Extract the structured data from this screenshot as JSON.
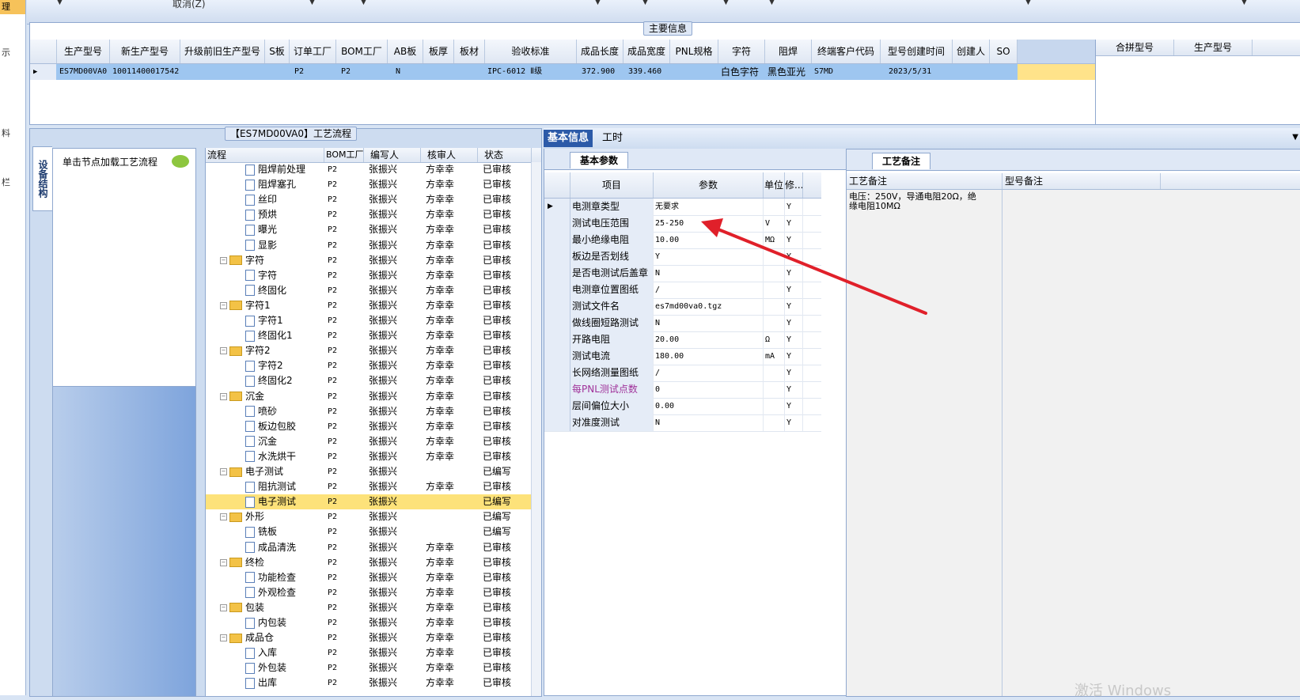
{
  "leftstrip": {
    "active_tab": "理",
    "glyphs": [
      "示",
      "料",
      "栏"
    ]
  },
  "toolbar": {
    "cancel_label": "取消(Z)"
  },
  "main_info": {
    "caption": "主要信息",
    "columns": [
      "生产型号",
      "新生产型号",
      "升级前旧生产型号",
      "S板",
      "订单工厂",
      "BOM工厂",
      "AB板",
      "板厚",
      "板材",
      "验收标准",
      "成品长度",
      "成品宽度",
      "PNL规格",
      "字符",
      "阻焊",
      "终端客户代码",
      "型号创建时间",
      "创建人",
      "SO"
    ],
    "row": [
      "ES7MD00VA0",
      "10011400017542",
      "",
      "",
      "P2",
      "P2",
      "N",
      "",
      "",
      "IPC-6012 Ⅱ级",
      "372.900",
      "339.460",
      "",
      "白色字符",
      "黑色亚光",
      "S7MD",
      "2023/5/31",
      "",
      ""
    ],
    "right_columns": [
      "合拼型号",
      "生产型号"
    ]
  },
  "process": {
    "caption": "【ES7MD00VA0】工艺流程",
    "vertical_tab": "设备结构",
    "load_hint": "单击节点加载工艺流程",
    "columns": [
      "流程",
      "BOM工厂",
      "编写人",
      "核审人",
      "状态"
    ],
    "rows": [
      {
        "level": 2,
        "type": "doc",
        "name": "阻焊前处理",
        "bom": "P2",
        "writer": "张振兴",
        "checker": "方幸幸",
        "status": "已审核"
      },
      {
        "level": 2,
        "type": "doc",
        "name": "阻焊塞孔",
        "bom": "P2",
        "writer": "张振兴",
        "checker": "方幸幸",
        "status": "已审核"
      },
      {
        "level": 2,
        "type": "doc",
        "name": "丝印",
        "bom": "P2",
        "writer": "张振兴",
        "checker": "方幸幸",
        "status": "已审核"
      },
      {
        "level": 2,
        "type": "doc",
        "name": "预烘",
        "bom": "P2",
        "writer": "张振兴",
        "checker": "方幸幸",
        "status": "已审核"
      },
      {
        "level": 2,
        "type": "doc",
        "name": "曝光",
        "bom": "P2",
        "writer": "张振兴",
        "checker": "方幸幸",
        "status": "已审核"
      },
      {
        "level": 2,
        "type": "doc",
        "name": "显影",
        "bom": "P2",
        "writer": "张振兴",
        "checker": "方幸幸",
        "status": "已审核"
      },
      {
        "level": 1,
        "type": "folder",
        "name": "字符",
        "bom": "P2",
        "writer": "张振兴",
        "checker": "方幸幸",
        "status": "已审核"
      },
      {
        "level": 2,
        "type": "doc",
        "name": "字符",
        "bom": "P2",
        "writer": "张振兴",
        "checker": "方幸幸",
        "status": "已审核"
      },
      {
        "level": 2,
        "type": "doc",
        "name": "终固化",
        "bom": "P2",
        "writer": "张振兴",
        "checker": "方幸幸",
        "status": "已审核"
      },
      {
        "level": 1,
        "type": "folder",
        "name": "字符1",
        "bom": "P2",
        "writer": "张振兴",
        "checker": "方幸幸",
        "status": "已审核"
      },
      {
        "level": 2,
        "type": "doc",
        "name": "字符1",
        "bom": "P2",
        "writer": "张振兴",
        "checker": "方幸幸",
        "status": "已审核"
      },
      {
        "level": 2,
        "type": "doc",
        "name": "终固化1",
        "bom": "P2",
        "writer": "张振兴",
        "checker": "方幸幸",
        "status": "已审核"
      },
      {
        "level": 1,
        "type": "folder",
        "name": "字符2",
        "bom": "P2",
        "writer": "张振兴",
        "checker": "方幸幸",
        "status": "已审核"
      },
      {
        "level": 2,
        "type": "doc",
        "name": "字符2",
        "bom": "P2",
        "writer": "张振兴",
        "checker": "方幸幸",
        "status": "已审核"
      },
      {
        "level": 2,
        "type": "doc",
        "name": "终固化2",
        "bom": "P2",
        "writer": "张振兴",
        "checker": "方幸幸",
        "status": "已审核"
      },
      {
        "level": 1,
        "type": "folder",
        "name": "沉金",
        "bom": "P2",
        "writer": "张振兴",
        "checker": "方幸幸",
        "status": "已审核"
      },
      {
        "level": 2,
        "type": "doc",
        "name": "喷砂",
        "bom": "P2",
        "writer": "张振兴",
        "checker": "方幸幸",
        "status": "已审核"
      },
      {
        "level": 2,
        "type": "doc",
        "name": "板边包胶",
        "bom": "P2",
        "writer": "张振兴",
        "checker": "方幸幸",
        "status": "已审核"
      },
      {
        "level": 2,
        "type": "doc",
        "name": "沉金",
        "bom": "P2",
        "writer": "张振兴",
        "checker": "方幸幸",
        "status": "已审核"
      },
      {
        "level": 2,
        "type": "doc",
        "name": "水洗烘干",
        "bom": "P2",
        "writer": "张振兴",
        "checker": "方幸幸",
        "status": "已审核"
      },
      {
        "level": 1,
        "type": "folder",
        "name": "电子测试",
        "bom": "P2",
        "writer": "张振兴",
        "checker": "",
        "status": "已编写"
      },
      {
        "level": 2,
        "type": "doc",
        "name": "阻抗测试",
        "bom": "P2",
        "writer": "张振兴",
        "checker": "方幸幸",
        "status": "已审核"
      },
      {
        "level": 2,
        "type": "doc",
        "name": "电子测试",
        "bom": "P2",
        "writer": "张振兴",
        "checker": "",
        "status": "已编写",
        "selected": true
      },
      {
        "level": 1,
        "type": "folder",
        "name": "外形",
        "bom": "P2",
        "writer": "张振兴",
        "checker": "",
        "status": "已编写"
      },
      {
        "level": 2,
        "type": "doc",
        "name": "铣板",
        "bom": "P2",
        "writer": "张振兴",
        "checker": "",
        "status": "已编写"
      },
      {
        "level": 2,
        "type": "doc",
        "name": "成品清洗",
        "bom": "P2",
        "writer": "张振兴",
        "checker": "方幸幸",
        "status": "已审核"
      },
      {
        "level": 1,
        "type": "folder",
        "name": "终检",
        "bom": "P2",
        "writer": "张振兴",
        "checker": "方幸幸",
        "status": "已审核"
      },
      {
        "level": 2,
        "type": "doc",
        "name": "功能检查",
        "bom": "P2",
        "writer": "张振兴",
        "checker": "方幸幸",
        "status": "已审核"
      },
      {
        "level": 2,
        "type": "doc",
        "name": "外观检查",
        "bom": "P2",
        "writer": "张振兴",
        "checker": "方幸幸",
        "status": "已审核"
      },
      {
        "level": 1,
        "type": "folder",
        "name": "包装",
        "bom": "P2",
        "writer": "张振兴",
        "checker": "方幸幸",
        "status": "已审核"
      },
      {
        "level": 2,
        "type": "doc",
        "name": "内包装",
        "bom": "P2",
        "writer": "张振兴",
        "checker": "方幸幸",
        "status": "已审核"
      },
      {
        "level": 1,
        "type": "folder",
        "name": "成品仓",
        "bom": "P2",
        "writer": "张振兴",
        "checker": "方幸幸",
        "status": "已审核"
      },
      {
        "level": 2,
        "type": "doc",
        "name": "入库",
        "bom": "P2",
        "writer": "张振兴",
        "checker": "方幸幸",
        "status": "已审核"
      },
      {
        "level": 2,
        "type": "doc",
        "name": "外包装",
        "bom": "P2",
        "writer": "张振兴",
        "checker": "方幸幸",
        "status": "已审核"
      },
      {
        "level": 2,
        "type": "doc",
        "name": "出库",
        "bom": "P2",
        "writer": "张振兴",
        "checker": "方幸幸",
        "status": "已审核"
      }
    ]
  },
  "tabs": {
    "basic": "基本信息",
    "time": "工时"
  },
  "params": {
    "caption": "基本参数",
    "columns": [
      "项目",
      "参数",
      "单位",
      "修..."
    ],
    "rows": [
      {
        "item": "电测章类型",
        "value": "无要求",
        "unit": "",
        "mod": "Y"
      },
      {
        "item": "测试电压范围",
        "value": "25-250",
        "unit": "V",
        "mod": "Y"
      },
      {
        "item": "最小绝缘电阻",
        "value": "10.00",
        "unit": "MΩ",
        "mod": "Y"
      },
      {
        "item": "板边是否划线",
        "value": "Y",
        "unit": "",
        "mod": "Y"
      },
      {
        "item": "是否电测试后盖章",
        "value": "N",
        "unit": "",
        "mod": "Y"
      },
      {
        "item": "电测章位置图纸",
        "value": "/",
        "unit": "",
        "mod": "Y"
      },
      {
        "item": "测试文件名",
        "value": "es7md00va0.tgz",
        "unit": "",
        "mod": "Y"
      },
      {
        "item": "做线圈短路测试",
        "value": "N",
        "unit": "",
        "mod": "Y"
      },
      {
        "item": "开路电阻",
        "value": "20.00",
        "unit": "Ω",
        "mod": "Y"
      },
      {
        "item": "测试电流",
        "value": "180.00",
        "unit": "mA",
        "mod": "Y"
      },
      {
        "item": "长网络测量图纸",
        "value": "/",
        "unit": "",
        "mod": "Y"
      },
      {
        "item": "每PNL测试点数",
        "value": "0",
        "unit": "",
        "mod": "Y",
        "highlight": true
      },
      {
        "item": "层间偏位大小",
        "value": "0.00",
        "unit": "",
        "mod": "Y"
      },
      {
        "item": "对准度测试",
        "value": "N",
        "unit": "",
        "mod": "Y"
      }
    ]
  },
  "remarks": {
    "caption": "工艺备注",
    "columns": [
      "工艺备注",
      "型号备注"
    ],
    "process_remark": "电压：250V，导通电阻20Ω，绝缘电阻10MΩ"
  },
  "watermark": "激活 Windows",
  "colors": {
    "accent": "#2c5aa8",
    "selected_row": "#fde27a",
    "grid_selected": "#9ec6f0",
    "arrow": "#e0202a"
  }
}
